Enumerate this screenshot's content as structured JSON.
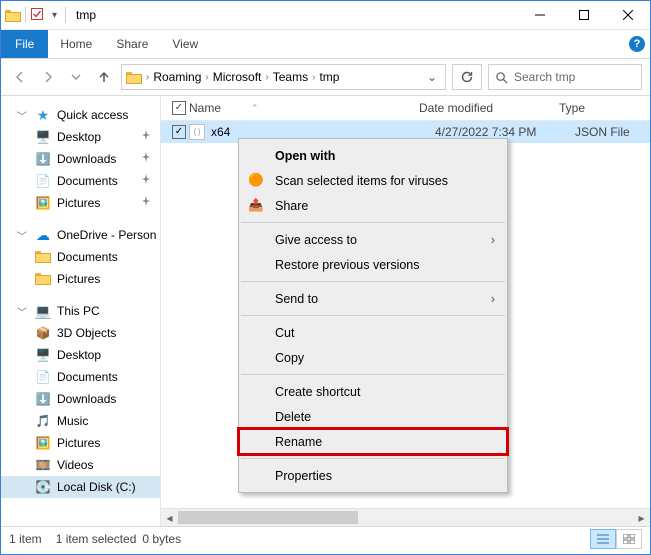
{
  "title": "tmp",
  "ribbon": {
    "file": "File",
    "home": "Home",
    "share": "Share",
    "view": "View"
  },
  "breadcrumbs": [
    "Roaming",
    "Microsoft",
    "Teams",
    "tmp"
  ],
  "search_placeholder": "Search tmp",
  "columns": {
    "name": "Name",
    "date": "Date modified",
    "type": "Type"
  },
  "file": {
    "name": "x64.json",
    "name_trunc": "x64",
    "date": "4/27/2022 7:34 PM",
    "type": "JSON File"
  },
  "nav": {
    "quick": "Quick access",
    "desktop": "Desktop",
    "downloads": "Downloads",
    "documents": "Documents",
    "pictures": "Pictures",
    "onedrive": "OneDrive - Person",
    "od_documents": "Documents",
    "od_pictures": "Pictures",
    "thispc": "This PC",
    "threeD": "3D Objects",
    "pc_desktop": "Desktop",
    "pc_documents": "Documents",
    "pc_downloads": "Downloads",
    "music": "Music",
    "pc_pictures": "Pictures",
    "videos": "Videos",
    "localdisk": "Local Disk (C:)"
  },
  "ctx": {
    "open_with": "Open with",
    "scan": "Scan selected items for viruses",
    "share": "Share",
    "give_access": "Give access to",
    "restore": "Restore previous versions",
    "send_to": "Send to",
    "cut": "Cut",
    "copy": "Copy",
    "create_shortcut": "Create shortcut",
    "delete": "Delete",
    "rename": "Rename",
    "properties": "Properties"
  },
  "status": {
    "count": "1 item",
    "selected": "1 item selected",
    "size": "0 bytes"
  }
}
